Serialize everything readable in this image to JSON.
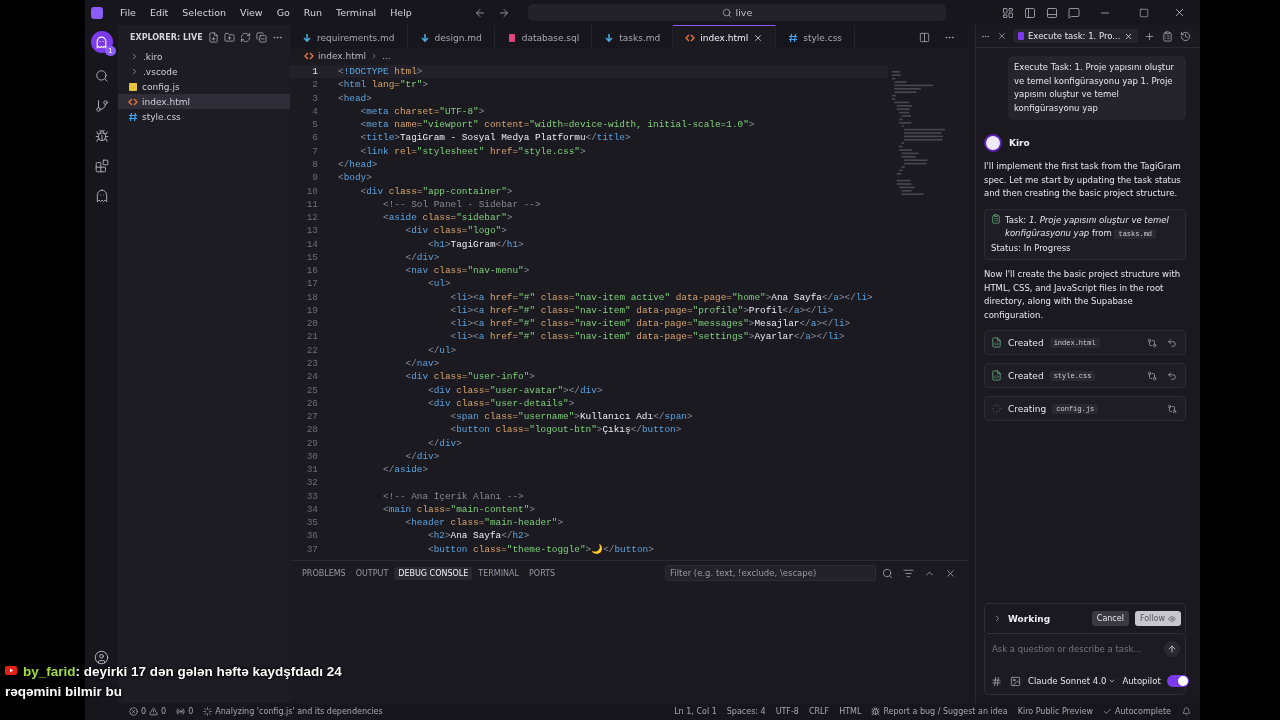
{
  "menu": [
    "File",
    "Edit",
    "Selection",
    "View",
    "Go",
    "Run",
    "Terminal",
    "Help"
  ],
  "command_search": {
    "value": "live"
  },
  "activity_bar": {
    "badge": "1"
  },
  "explorer": {
    "title": "EXPLORER: LIVE",
    "items": [
      {
        "name": ".kiro",
        "kind": "folder",
        "expanded": false,
        "selected": false
      },
      {
        "name": ".vscode",
        "kind": "folder",
        "expanded": false,
        "selected": false
      },
      {
        "name": "config.js",
        "kind": "js",
        "selected": false
      },
      {
        "name": "index.html",
        "kind": "html",
        "selected": true
      },
      {
        "name": "style.css",
        "kind": "css",
        "selected": false
      }
    ]
  },
  "editor": {
    "tabs": [
      {
        "label": "requirements.md",
        "kind": "md",
        "selected": false
      },
      {
        "label": "design.md",
        "kind": "md",
        "selected": false
      },
      {
        "label": "database.sql",
        "kind": "sql",
        "selected": false
      },
      {
        "label": "tasks.md",
        "kind": "md",
        "selected": false
      },
      {
        "label": "index.html",
        "kind": "html",
        "selected": true
      },
      {
        "label": "style.css",
        "kind": "css",
        "selected": false
      }
    ],
    "breadcrumb": [
      "index.html",
      "..."
    ],
    "lines": [
      {
        "number": "1",
        "code": "<!DOCTYPE html>",
        "current": true
      },
      {
        "number": "2",
        "code": "<html lang=\"tr\">",
        "current": false
      },
      {
        "number": "3",
        "code": "<head>",
        "current": false
      },
      {
        "number": "4",
        "code": "    <meta charset=\"UTF-8\">",
        "current": false
      },
      {
        "number": "5",
        "code": "    <meta name=\"viewport\" content=\"width=device-width, initial-scale=1.0\">",
        "current": false
      },
      {
        "number": "6",
        "code": "    <title>TagiGram - Sosyal Medya Platformu</title>",
        "current": false
      },
      {
        "number": "7",
        "code": "    <link rel=\"stylesheet\" href=\"style.css\">",
        "current": false
      },
      {
        "number": "8",
        "code": "</head>",
        "current": false
      },
      {
        "number": "9",
        "code": "<body>",
        "current": false
      },
      {
        "number": "10",
        "code": "    <div class=\"app-container\">",
        "current": false
      },
      {
        "number": "11",
        "code": "        <!-- Sol Panel - Sidebar -->",
        "current": false
      },
      {
        "number": "12",
        "code": "        <aside class=\"sidebar\">",
        "current": false
      },
      {
        "number": "13",
        "code": "            <div class=\"logo\">",
        "current": false
      },
      {
        "number": "14",
        "code": "                <h1>TagiGram</h1>",
        "current": false
      },
      {
        "number": "15",
        "code": "            </div>",
        "current": false
      },
      {
        "number": "16",
        "code": "            <nav class=\"nav-menu\">",
        "current": false
      },
      {
        "number": "17",
        "code": "                <ul>",
        "current": false
      },
      {
        "number": "18",
        "code": "                    <li><a href=\"#\" class=\"nav-item active\" data-page=\"home\">Ana Sayfa</a></li>",
        "current": false
      },
      {
        "number": "19",
        "code": "                    <li><a href=\"#\" class=\"nav-item\" data-page=\"profile\">Profil</a></li>",
        "current": false
      },
      {
        "number": "20",
        "code": "                    <li><a href=\"#\" class=\"nav-item\" data-page=\"messages\">Mesajlar</a></li>",
        "current": false
      },
      {
        "number": "21",
        "code": "                    <li><a href=\"#\" class=\"nav-item\" data-page=\"settings\">Ayarlar</a></li>",
        "current": false
      },
      {
        "number": "22",
        "code": "                </ul>",
        "current": false
      },
      {
        "number": "23",
        "code": "            </nav>",
        "current": false
      },
      {
        "number": "24",
        "code": "            <div class=\"user-info\">",
        "current": false
      },
      {
        "number": "25",
        "code": "                <div class=\"user-avatar\"></div>",
        "current": false
      },
      {
        "number": "26",
        "code": "                <div class=\"user-details\">",
        "current": false
      },
      {
        "number": "27",
        "code": "                    <span class=\"username\">Kullanıcı Adı</span>",
        "current": false
      },
      {
        "number": "28",
        "code": "                    <button class=\"logout-btn\">Çıkış</button>",
        "current": false
      },
      {
        "number": "29",
        "code": "                </div>",
        "current": false
      },
      {
        "number": "30",
        "code": "            </div>",
        "current": false
      },
      {
        "number": "31",
        "code": "        </aside>",
        "current": false
      },
      {
        "number": "32",
        "current": false
      },
      {
        "number": "33",
        "code": "        <!-- Ana İçerik Alanı -->",
        "current": false
      },
      {
        "number": "34",
        "code": "        <main class=\"main-content\">",
        "current": false
      },
      {
        "number": "35",
        "code": "            <header class=\"main-header\">",
        "current": false
      },
      {
        "number": "36",
        "code": "                <h2>Ana Sayfa</h2>",
        "current": false
      },
      {
        "number": "37",
        "code": "                <button class=\"theme-toggle\">🌙</button>",
        "current": false
      }
    ]
  },
  "panel": {
    "tabs": [
      {
        "label": "PROBLEMS",
        "selected": false
      },
      {
        "label": "OUTPUT",
        "selected": false
      },
      {
        "label": "DEBUG CONSOLE",
        "selected": true
      },
      {
        "label": "TERMINAL",
        "selected": false
      },
      {
        "label": "PORTS",
        "selected": false
      }
    ],
    "filter": {
      "placeholder": "Filter (e.g. text, !exclude, \\escape)"
    }
  },
  "chat": {
    "tab": {
      "title": "Execute task: 1. Pro..."
    },
    "user_message": "Execute Task: 1. Proje yapısını oluştur ve temel konfigürasyonu yap 1. Proje yapısını oluştur ve temel konfigürasyonu yap",
    "assistant": {
      "name": "Kiro",
      "intro": "I'll implement the first task from the TagiGram spec. Let me start by updating the task status and then creating the basic project structure.",
      "task": {
        "text": "Task: *1. Proje yapısını oluştur ve temel konfigürasyonu yap* from",
        "file": "tasks.md",
        "status": "Status: In Progress"
      },
      "note": "Now I'll create the basic project structure with HTML, CSS, and JavaScript files in the root directory, along with the Supabase configuration.",
      "actions": [
        {
          "kind": "created",
          "label": "Created",
          "file": "index.html"
        },
        {
          "kind": "created",
          "label": "Created",
          "file": "style.css"
        },
        {
          "kind": "creating",
          "label": "Creating",
          "file": "config.js"
        }
      ]
    },
    "working": {
      "label": "Working",
      "cancel": "Cancel",
      "follow": "Follow"
    },
    "input": {
      "placeholder": "Ask a question or describe a task..."
    },
    "model": "Claude Sonnet 4.0",
    "autopilot": {
      "label": "Autopilot",
      "on": true
    }
  },
  "status_bar": {
    "errors": "0",
    "warnings": "0",
    "ports": "0",
    "activity": "Analyzing 'config.js' and its dependencies",
    "items": [
      "Ln 1, Col 1",
      "Spaces: 4",
      "UTF-8",
      "CRLF",
      "HTML"
    ],
    "report": "Report a bug / Suggest an idea",
    "preview": "Kiro Public Preview",
    "autocomplete": "Autocomplete"
  },
  "stream_chat": {
    "user": "by_farid",
    "message": ": deyirki 17 dən gələn həftə kaydşfdadı 24 rəqəmini bilmir bu"
  }
}
